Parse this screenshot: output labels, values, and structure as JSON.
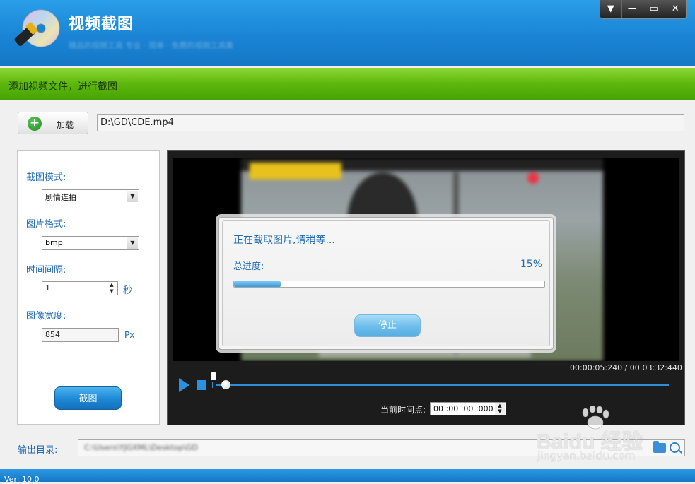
{
  "app": {
    "title": "视频截图",
    "subtitle": "精品的视频工具 专业 · 简单 · 免费的视频工具集",
    "version": "Ver: 10.0"
  },
  "window_controls": [
    "▼",
    "—",
    "▭",
    "✕"
  ],
  "status_bar": {
    "text": "添加视频文件，进行截图"
  },
  "load": {
    "button_label": "加载",
    "file_path": "D:\\GD\\CDE.mp4"
  },
  "settings": {
    "mode_label": "截图模式:",
    "mode_value": "剧情连拍",
    "format_label": "图片格式:",
    "format_value": "bmp",
    "interval_label": "时间间隔:",
    "interval_value": "1",
    "interval_unit": "秒",
    "width_label": "图像宽度:",
    "width_value": "854",
    "width_unit": "Px",
    "capture_button": "截图"
  },
  "player": {
    "timecode": "00:00:05:240 / 00:03:32:440",
    "current_time_label": "当前时间点:",
    "current_time_value": "00 :00 :00 :000",
    "seek_position_fraction": 0.02
  },
  "dialog": {
    "message": "正在截取图片,请稍等...",
    "progress_label": "总进度:",
    "progress_percent": "15%",
    "progress_value": 15,
    "stop_button": "停止"
  },
  "output": {
    "label": "输出目录:",
    "path": "C:\\Users\\YJGXML\\Desktop\\GD"
  },
  "watermark": {
    "text": "Baidu 经验",
    "url": "jingyan.baidu.com"
  },
  "colors": {
    "header_blue": "#1a84d4",
    "status_green": "#5cb80c",
    "accent_blue": "#1e69b4"
  }
}
